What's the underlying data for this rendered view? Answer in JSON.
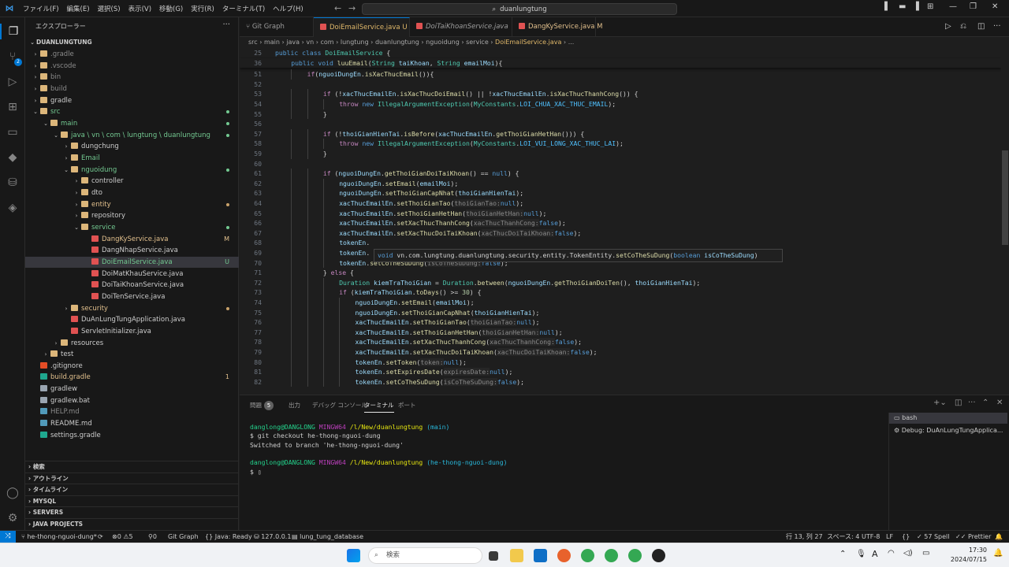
{
  "titlebar": {
    "menu": [
      "ファイル(F)",
      "編集(E)",
      "選択(S)",
      "表示(V)",
      "移動(G)",
      "実行(R)",
      "ターミナル(T)",
      "ヘルプ(H)"
    ],
    "search": "duanlungtung"
  },
  "sidebar": {
    "header": "エクスプローラー",
    "root": "DUANLUNGTUNG",
    "tree": [
      {
        "label": ".gradle",
        "depth": 1,
        "chev": "›",
        "icon": "folder",
        "color": "gray"
      },
      {
        "label": ".vscode",
        "depth": 1,
        "chev": "›",
        "icon": "folder",
        "color": "gray"
      },
      {
        "label": "bin",
        "depth": 1,
        "chev": "›",
        "icon": "folder",
        "color": "gray"
      },
      {
        "label": "build",
        "depth": 1,
        "chev": "›",
        "icon": "folder",
        "color": "gray"
      },
      {
        "label": "gradle",
        "depth": 1,
        "chev": "›",
        "icon": "folder",
        "color": ""
      },
      {
        "label": "src",
        "depth": 1,
        "chev": "⌄",
        "icon": "folder",
        "color": "green",
        "dot": "g"
      },
      {
        "label": "main",
        "depth": 2,
        "chev": "⌄",
        "icon": "folder",
        "color": "green",
        "dot": "g"
      },
      {
        "label": "java \\ vn \\ com \\ lungtung \\ duanlungtung",
        "depth": 3,
        "chev": "⌄",
        "icon": "folder",
        "color": "green",
        "dot": "g"
      },
      {
        "label": "dungchung",
        "depth": 4,
        "chev": "›",
        "icon": "folder",
        "color": ""
      },
      {
        "label": "Email",
        "depth": 4,
        "chev": "›",
        "icon": "folder",
        "color": "green"
      },
      {
        "label": "nguoidung",
        "depth": 4,
        "chev": "⌄",
        "icon": "folder",
        "color": "green",
        "dot": "g"
      },
      {
        "label": "controller",
        "depth": 5,
        "chev": "›",
        "icon": "folder",
        "color": ""
      },
      {
        "label": "dto",
        "depth": 5,
        "chev": "›",
        "icon": "folder",
        "color": ""
      },
      {
        "label": "entity",
        "depth": 5,
        "chev": "›",
        "icon": "folder",
        "color": "yellow",
        "dot": "y"
      },
      {
        "label": "repository",
        "depth": 5,
        "chev": "›",
        "icon": "folder",
        "color": ""
      },
      {
        "label": "service",
        "depth": 5,
        "chev": "⌄",
        "icon": "folder",
        "color": "green",
        "dot": "g"
      },
      {
        "label": "DangKyService.java",
        "depth": 6,
        "chev": "",
        "icon": "java",
        "color": "yellow",
        "mod": "M"
      },
      {
        "label": "DangNhapService.java",
        "depth": 6,
        "chev": "",
        "icon": "java",
        "color": ""
      },
      {
        "label": "DoiEmailService.java",
        "depth": 6,
        "chev": "",
        "icon": "java",
        "color": "green",
        "mod": "U",
        "selected": true
      },
      {
        "label": "DoiMatKhauService.java",
        "depth": 6,
        "chev": "",
        "icon": "java",
        "color": ""
      },
      {
        "label": "DoiTaiKhoanService.java",
        "depth": 6,
        "chev": "",
        "icon": "java",
        "color": ""
      },
      {
        "label": "DoiTenService.java",
        "depth": 6,
        "chev": "",
        "icon": "java",
        "color": ""
      },
      {
        "label": "security",
        "depth": 4,
        "chev": "›",
        "icon": "folder",
        "color": "yellow",
        "dot": "y"
      },
      {
        "label": "DuAnLungTungApplication.java",
        "depth": 4,
        "chev": "",
        "icon": "java",
        "color": ""
      },
      {
        "label": "ServletInitializer.java",
        "depth": 4,
        "chev": "",
        "icon": "java",
        "color": ""
      },
      {
        "label": "resources",
        "depth": 3,
        "chev": "›",
        "icon": "folder",
        "color": ""
      },
      {
        "label": "test",
        "depth": 2,
        "chev": "›",
        "icon": "folder",
        "color": ""
      },
      {
        "label": ".gitignore",
        "depth": 1,
        "chev": "",
        "icon": "git",
        "color": ""
      },
      {
        "label": "build.gradle",
        "depth": 1,
        "chev": "",
        "icon": "gradle",
        "color": "yellow",
        "mod": "1"
      },
      {
        "label": "gradlew",
        "depth": 1,
        "chev": "",
        "icon": "file",
        "color": ""
      },
      {
        "label": "gradlew.bat",
        "depth": 1,
        "chev": "",
        "icon": "file",
        "color": ""
      },
      {
        "label": "HELP.md",
        "depth": 1,
        "chev": "",
        "icon": "md",
        "color": "gray"
      },
      {
        "label": "README.md",
        "depth": 1,
        "chev": "",
        "icon": "md",
        "color": ""
      },
      {
        "label": "settings.gradle",
        "depth": 1,
        "chev": "",
        "icon": "gradle",
        "color": ""
      }
    ],
    "sections": [
      "検索",
      "アウトライン",
      "タイムライン",
      "MYSQL",
      "SERVERS",
      "JAVA PROJECTS"
    ]
  },
  "tabs": [
    {
      "label": "Git Graph",
      "suffix": "",
      "active": false
    },
    {
      "label": "DoiEmailService.java",
      "suffix": "U",
      "active": true
    },
    {
      "label": "DoiTaiKhoanService.java",
      "suffix": "",
      "active": false
    },
    {
      "label": "DangKyService.java",
      "suffix": "M",
      "active": false
    }
  ],
  "breadcrumb": [
    "src",
    "main",
    "java",
    "vn",
    "com",
    "lungtung",
    "duanlungtung",
    "nguoidung",
    "service",
    "DoiEmailService.java",
    "..."
  ],
  "editor": {
    "lines": [
      {
        "n": "25",
        "html": "<span class='kw'>public</span> <span class='kw'>class</span> <span class='ty'>DoiEmailService</span> {",
        "indent": 0,
        "sticky": true
      },
      {
        "n": "36",
        "html": "<span class='kw'>public</span> <span class='kw'>void</span> <span class='fn'>luuEmail</span>(<span class='ty'>String</span> <span class='va'>taiKhoan</span>, <span class='ty'>String</span> <span class='va'>emailMoi</span>){",
        "indent": 1,
        "sticky": true
      },
      {
        "n": "51",
        "html": "<span class='kw2'>if</span>(<span class='va'>nguoiDungEn</span>.<span class='fn'>isXacThucEmail</span>()){",
        "indent": 2
      },
      {
        "n": "52",
        "html": "",
        "indent": 0
      },
      {
        "n": "53",
        "html": "<span class='kw2'>if</span> (!<span class='va'>xacThucEmailEn</span>.<span class='fn'>isXacThucDoiEmail</span>() || !<span class='va'>xacThucEmailEn</span>.<span class='fn'>isXacThucThanhCong</span>()) {",
        "indent": 3
      },
      {
        "n": "54",
        "html": "<span class='kw2'>throw</span> <span class='kw'>new</span> <span class='ty'>IllegalArgumentException</span>(<span class='ty'>MyConstants</span>.<span class='co'>LOI_CHUA_XAC_THUC_EMAIL</span>);",
        "indent": 4
      },
      {
        "n": "55",
        "html": "}",
        "indent": 3
      },
      {
        "n": "56",
        "html": "",
        "indent": 0
      },
      {
        "n": "57",
        "html": "<span class='kw2'>if</span> (!<span class='va'>thoiGianHienTai</span>.<span class='fn'>isBefore</span>(<span class='va'>xacThucEmailEn</span>.<span class='fn'>getThoiGianHetHan</span>())) {",
        "indent": 3
      },
      {
        "n": "58",
        "html": "<span class='kw2'>throw</span> <span class='kw'>new</span> <span class='ty'>IllegalArgumentException</span>(<span class='ty'>MyConstants</span>.<span class='co'>LOI_VUI_LONG_XAC_THUC_LAI</span>);",
        "indent": 4
      },
      {
        "n": "59",
        "html": "}",
        "indent": 3
      },
      {
        "n": "60",
        "html": "",
        "indent": 0
      },
      {
        "n": "61",
        "html": "<span class='kw2'>if</span> (<span class='va'>nguoiDungEn</span>.<span class='fn'>getThoiGianDoiTaiKhoan</span>() == <span class='kw'>null</span>) {",
        "indent": 3
      },
      {
        "n": "62",
        "html": "<span class='va'>nguoiDungEn</span>.<span class='fn'>setEmail</span>(<span class='va'>emailMoi</span>);",
        "indent": 4
      },
      {
        "n": "63",
        "html": "<span class='va'>nguoiDungEn</span>.<span class='fn'>setThoiGianCapNhat</span>(<span class='va'>thoiGianHienTai</span>);",
        "indent": 4
      },
      {
        "n": "64",
        "html": "<span class='va'>xacThucEmailEn</span>.<span class='fn'>setThoiGianTao</span>(<span class='hint'>thoiGianTao:</span><span class='kw'>null</span>);",
        "indent": 4
      },
      {
        "n": "65",
        "html": "<span class='va'>xacThucEmailEn</span>.<span class='fn'>setThoiGianHetHan</span>(<span class='hint'>thoiGianHetHan:</span><span class='kw'>null</span>);",
        "indent": 4
      },
      {
        "n": "66",
        "html": "<span class='va'>xacThucEmailEn</span>.<span class='fn'>setXacThucThanhCong</span>(<span class='hint'>xacThucThanhCong:</span><span class='kw'>false</span>);",
        "indent": 4
      },
      {
        "n": "67",
        "html": "<span class='va'>xacThucEmailEn</span>.<span class='fn'>setXacThucDoiTaiKhoan</span>(<span class='hint'>xacThucDoiTaiKhoan:</span><span class='kw'>false</span>);",
        "indent": 4
      },
      {
        "n": "68",
        "html": "<span class='va'>tokenEn</span>.",
        "indent": 4
      },
      {
        "n": "69",
        "html": "<span class='va'>tokenEn</span>.",
        "indent": 4
      },
      {
        "n": "70",
        "html": "<span class='va'>tokenEn</span>.<span class='fn'>setCoTheSuDung</span>(<span class='hint'>isCoTheSuDung:</span><span class='kw'>false</span>);",
        "indent": 4
      },
      {
        "n": "71",
        "html": "} <span class='kw2'>else</span> {",
        "indent": 3
      },
      {
        "n": "72",
        "html": "<span class='ty'>Duration</span> <span class='va'>kiemTraThoiGian</span> = <span class='ty'>Duration</span>.<span class='fn'>between</span>(<span class='va'>nguoiDungEn</span>.<span class='fn'>getThoiGianDoiTen</span>(), <span class='va'>thoiGianHienTai</span>);",
        "indent": 4
      },
      {
        "n": "73",
        "html": "<span class='kw2'>if</span> (<span class='va'>kiemTraThoiGian</span>.<span class='fn'>toDays</span>() >= <span style='color:#b5cea8'>30</span>) {",
        "indent": 4
      },
      {
        "n": "74",
        "html": "<span class='va'>nguoiDungEn</span>.<span class='fn'>setEmail</span>(<span class='va'>emailMoi</span>);",
        "indent": 5
      },
      {
        "n": "75",
        "html": "<span class='va'>nguoiDungEn</span>.<span class='fn'>setThoiGianCapNhat</span>(<span class='va'>thoiGianHienTai</span>);",
        "indent": 5
      },
      {
        "n": "76",
        "html": "<span class='va'>xacThucEmailEn</span>.<span class='fn'>setThoiGianTao</span>(<span class='hint'>thoiGianTao:</span><span class='kw'>null</span>);",
        "indent": 5
      },
      {
        "n": "77",
        "html": "<span class='va'>xacThucEmailEn</span>.<span class='fn'>setThoiGianHetHan</span>(<span class='hint'>thoiGianHetHan:</span><span class='kw'>null</span>);",
        "indent": 5
      },
      {
        "n": "78",
        "html": "<span class='va'>xacThucEmailEn</span>.<span class='fn'>setXacThucThanhCong</span>(<span class='hint'>xacThucThanhCong:</span><span class='kw'>false</span>);",
        "indent": 5
      },
      {
        "n": "79",
        "html": "<span class='va'>xacThucEmailEn</span>.<span class='fn'>setXacThucDoiTaiKhoan</span>(<span class='hint'>xacThucDoiTaiKhoan:</span><span class='kw'>false</span>);",
        "indent": 5
      },
      {
        "n": "80",
        "html": "<span class='va'>tokenEn</span>.<span class='fn'>setToken</span>(<span class='hint'>token:</span><span class='kw'>null</span>);",
        "indent": 5
      },
      {
        "n": "81",
        "html": "<span class='va'>tokenEn</span>.<span class='fn'>setExpiresDate</span>(<span class='hint'>expiresDate:</span><span class='kw'>null</span>);",
        "indent": 5
      },
      {
        "n": "82",
        "html": "<span class='va'>tokenEn</span>.<span class='fn'>setCoTheSuDung</span>(<span class='hint'>isCoTheSuDung:</span><span class='kw'>false</span>);",
        "indent": 5
      }
    ],
    "hover": "<span class='kw'>void</span> vn.com.lungtung.duanlungtung.security.entity.TokenEntity.<span class='fn'>setCoTheSuDung</span>(<span class='kw'>boolean</span> <span class='va'>isCoTheSuDung</span>)"
  },
  "panel": {
    "tabs": [
      "問題",
      "出力",
      "デバッグ コンソール",
      "ターミナル",
      "ポート"
    ],
    "problems_count": "5",
    "terminal": [
      {
        "user": "danglong@DANGLONG",
        "host": "MINGW64",
        "path": "/l/New/duanlungtung",
        "branch": "(main)"
      },
      {
        "text": "$ git checkout he-thong-nguoi-dung"
      },
      {
        "text": "Switched to branch 'he-thong-nguoi-dung'"
      },
      {
        "text": ""
      },
      {
        "user": "danglong@DANGLONG",
        "host": "MINGW64",
        "path": "/l/New/duanlungtung",
        "branch": "(he-thong-nguoi-dung)"
      },
      {
        "text": "$ ",
        "cursor": true
      }
    ],
    "terminal_list": [
      "bash",
      "Debug: DuAnLungTungApplica..."
    ]
  },
  "statusbar": {
    "branch": "he-thong-nguoi-dung*",
    "errors": "0",
    "warnings": "5",
    "ports": "0",
    "git_graph": "Git Graph",
    "java": "Java: Ready",
    "db_host": "127.0.0.1",
    "db_name": "lung_tung_database",
    "position": "行 13, 列 27",
    "spaces": "スペース: 4",
    "encoding": "UTF-8",
    "eol": "LF",
    "lang": "{}",
    "spell": "57 Spell",
    "prettier": "Prettier"
  },
  "taskbar": {
    "search": "検索",
    "time": "17:30",
    "date": "2024/07/15"
  }
}
